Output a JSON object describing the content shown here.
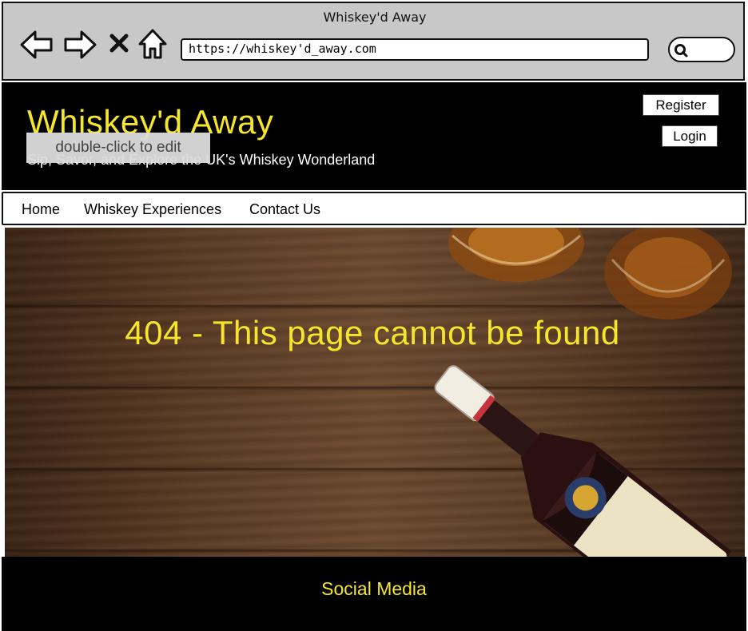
{
  "browser": {
    "window_title": "Whiskey'd Away",
    "url": "https://whiskey'd_away.com",
    "icons": [
      "back-arrow-icon",
      "forward-arrow-icon",
      "close-icon",
      "home-icon",
      "search-icon"
    ]
  },
  "header": {
    "site_title": "Whiskey'd Away",
    "tagline": "Sip, Savor, and Explore the UK's Whiskey Wonderland",
    "edit_tooltip": "double-click to edit",
    "register_label": "Register",
    "login_label": "Login"
  },
  "nav": {
    "items": [
      {
        "label": "Home"
      },
      {
        "label": "Whiskey Experiences"
      },
      {
        "label": "Contact Us"
      }
    ]
  },
  "main": {
    "error_heading": "404 - This page cannot be found",
    "hero_image": "whiskey-bottle-and-glasses-on-wood"
  },
  "footer": {
    "social_heading": "Social Media"
  },
  "colors": {
    "accent_yellow": "#f5e62a",
    "header_bg": "#000000",
    "chrome_bg": "#c8c8c8"
  }
}
